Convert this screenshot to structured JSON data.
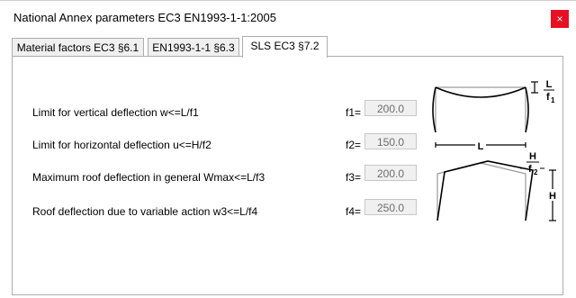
{
  "window": {
    "title": "National Annex parameters EC3 EN1993-1-1:2005",
    "close_glyph": "×"
  },
  "tabs": [
    {
      "label": "Material factors EC3 §6.1",
      "active": false
    },
    {
      "label": "EN1993-1-1 §6.3",
      "active": false
    },
    {
      "label": "SLS EC3 §7.2",
      "active": true
    }
  ],
  "rows": [
    {
      "label": "Limit for vertical deflection w<=L/f1",
      "field_label": "f1=",
      "value": "200.0"
    },
    {
      "label": "Limit for horizontal deflection u<=H/f2",
      "field_label": "f2=",
      "value": "150.0"
    },
    {
      "label": "Maximum roof deflection in general Wmax<=L/f3",
      "field_label": "f3=",
      "value": "200.0"
    },
    {
      "label": "Roof deflection due to variable action w3<=L/f4",
      "field_label": "f4=",
      "value": "250.0"
    }
  ],
  "diagram": {
    "vert_L": "L",
    "vert_f": "f",
    "vert_sub": "1",
    "span_L": "L",
    "horiz_H": "H",
    "horiz_f": "f",
    "horiz_sub": "2",
    "height_H": "H"
  }
}
